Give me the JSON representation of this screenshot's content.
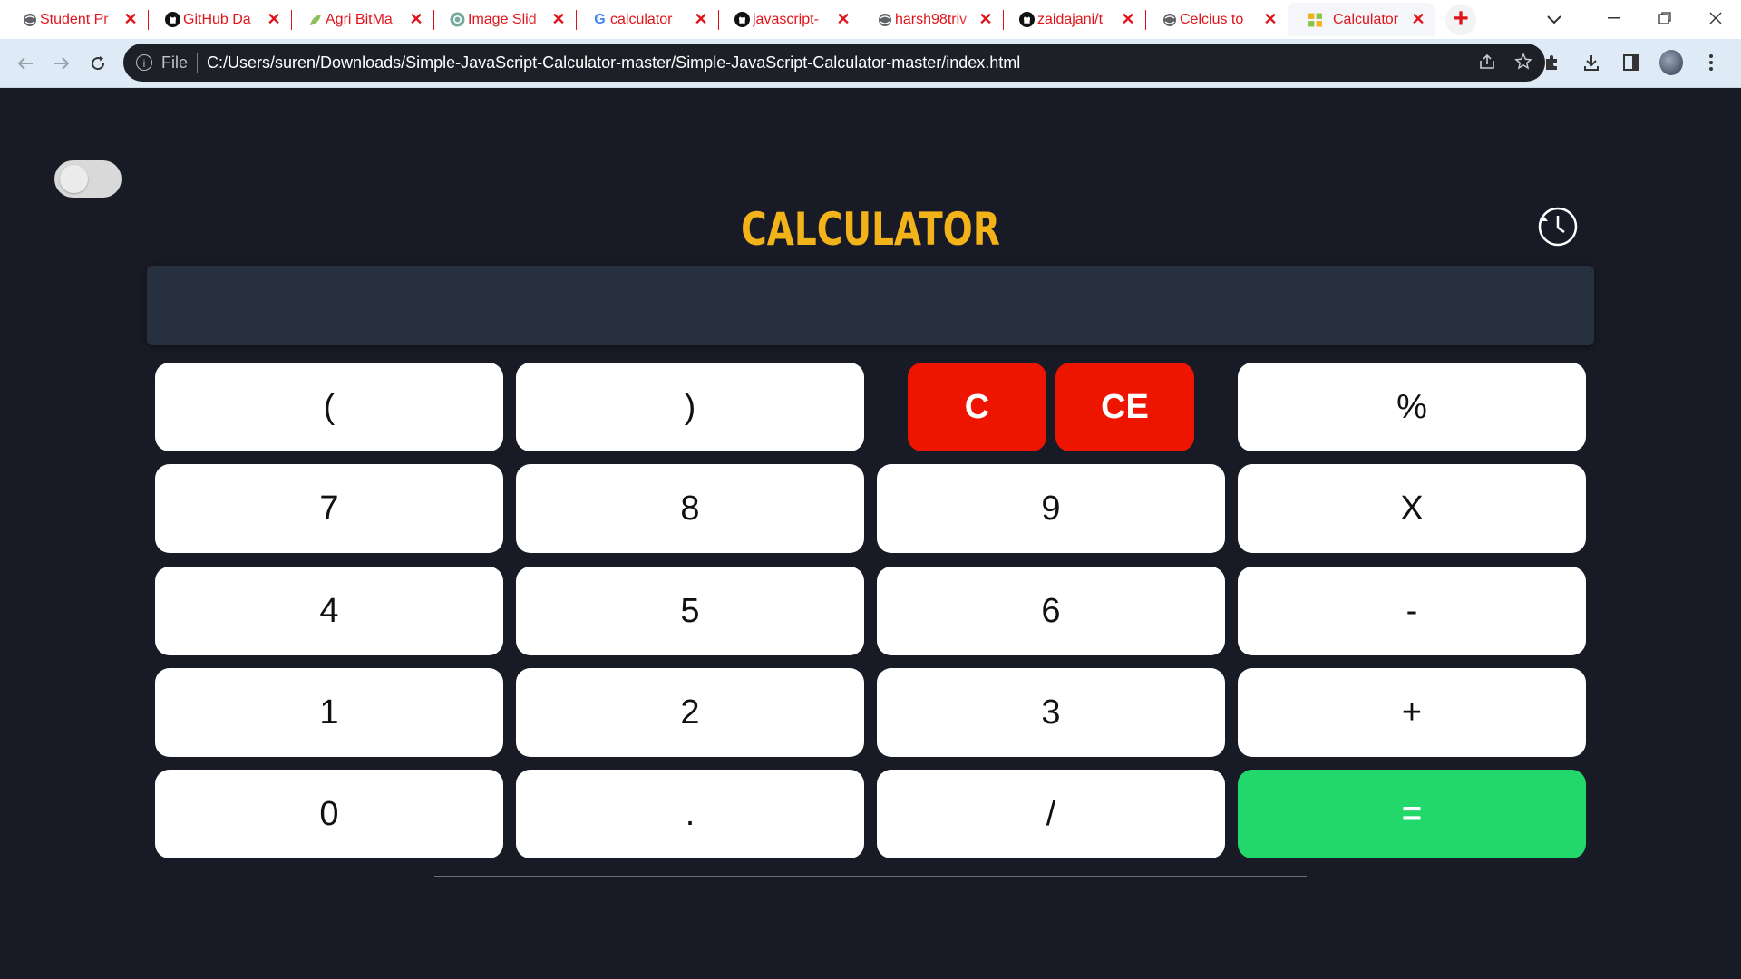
{
  "browser": {
    "tabs": [
      {
        "label": "Student Pr",
        "icon": "globe-icon",
        "active": false
      },
      {
        "label": "GitHub Da",
        "icon": "github-icon",
        "active": false
      },
      {
        "label": "Agri BitMa",
        "icon": "leaf-icon",
        "active": false
      },
      {
        "label": "Image Slid",
        "icon": "openai-icon",
        "active": false
      },
      {
        "label": "calculator",
        "icon": "google-icon",
        "active": false
      },
      {
        "label": "javascript-",
        "icon": "github-icon",
        "active": false
      },
      {
        "label": "harsh98triv",
        "icon": "globe-icon",
        "active": false
      },
      {
        "label": "zaidajani/t",
        "icon": "github-icon",
        "active": false
      },
      {
        "label": "Celcius to",
        "icon": "globe-icon",
        "active": false
      },
      {
        "label": "Calculator",
        "icon": "calculator-favicon",
        "active": true
      }
    ],
    "tab_close_glyph": "✕",
    "new_tab_glyph": "+",
    "address": {
      "scheme_label": "File",
      "url": "C:/Users/suren/Downloads/Simple-JavaScript-Calculator-master/Simple-JavaScript-Calculator-master/index.html"
    }
  },
  "page": {
    "title": "CALCULATOR",
    "display_value": "",
    "theme_toggle_on": false,
    "keys": {
      "open_paren": "(",
      "close_paren": ")",
      "clear": "C",
      "clear_entry": "CE",
      "percent": "%",
      "seven": "7",
      "eight": "8",
      "nine": "9",
      "multiply": "X",
      "four": "4",
      "five": "5",
      "six": "6",
      "minus": "-",
      "one": "1",
      "two": "2",
      "three": "3",
      "plus": "+",
      "zero": "0",
      "dot": ".",
      "divide": "/",
      "equals": "="
    }
  },
  "colors": {
    "page_bg": "#181b26",
    "title": "#f1b21a",
    "display_bg": "#27303f",
    "clear_keys": "#ee1500",
    "equals_key": "#22d86b",
    "tab_text": "#e0141b"
  }
}
